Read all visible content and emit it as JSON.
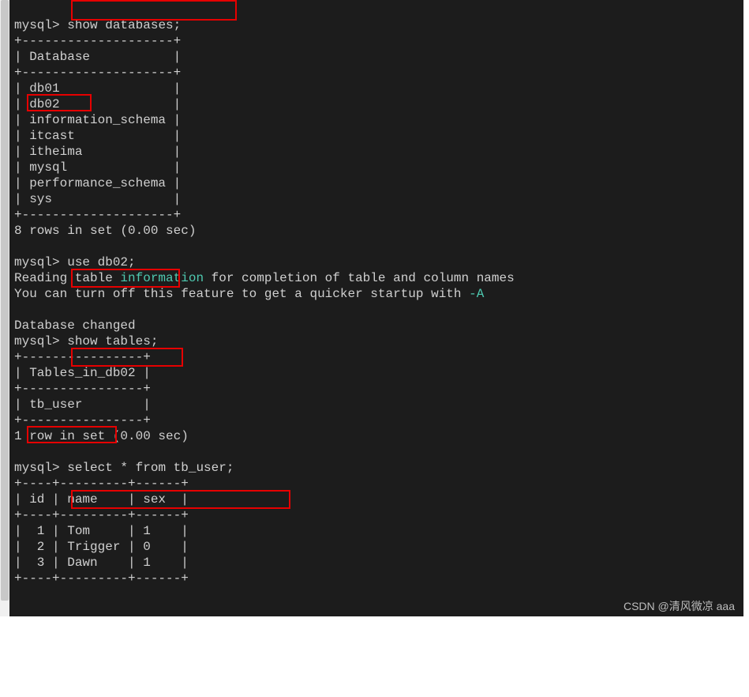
{
  "prompt": "mysql>",
  "cmd1": "show databases;",
  "db_border_top": "+--------------------+",
  "db_header": "| Database           |",
  "db_border_mid": "+--------------------+",
  "db_rows": {
    "r0": "| db01               |",
    "r1": "| db02               |",
    "r2": "| information_schema |",
    "r3": "| itcast             |",
    "r4": "| itheima            |",
    "r5": "| mysql              |",
    "r6": "| performance_schema |",
    "r7": "| sys                |"
  },
  "db_border_bot": "+--------------------+",
  "db_summary": "8 rows in set (0.00 sec)",
  "cmd2": "use db02;",
  "reading1a": "Reading table ",
  "reading1b": "information",
  "reading1c": " for completion of table and column names",
  "reading2a": "You can turn off this feature to get a quicker startup with ",
  "reading2b": "-A",
  "db_changed": "Database changed",
  "cmd3": "show tables;",
  "tb_border_top": "+----------------+",
  "tb_header": "| Tables_in_db02 |",
  "tb_border_mid": "+----------------+",
  "tb_rows": {
    "r0": "| tb_user        |"
  },
  "tb_border_bot": "+----------------+",
  "tb_summary": "1 row in set (0.00 sec)",
  "cmd4": "select * from tb_user;",
  "sel_border_top": "+----+---------+------+",
  "sel_header": "| id | name    | sex  |",
  "sel_border_mid": "+----+---------+------+",
  "sel_rows": {
    "r0": "|  1 | Tom     | 1    |",
    "r1": "|  2 | Trigger | 0    |",
    "r2": "|  3 | Dawn    | 1    |"
  },
  "sel_border_bot": "+----+---------+------+",
  "watermark": "CSDN @清风微凉 aaa"
}
